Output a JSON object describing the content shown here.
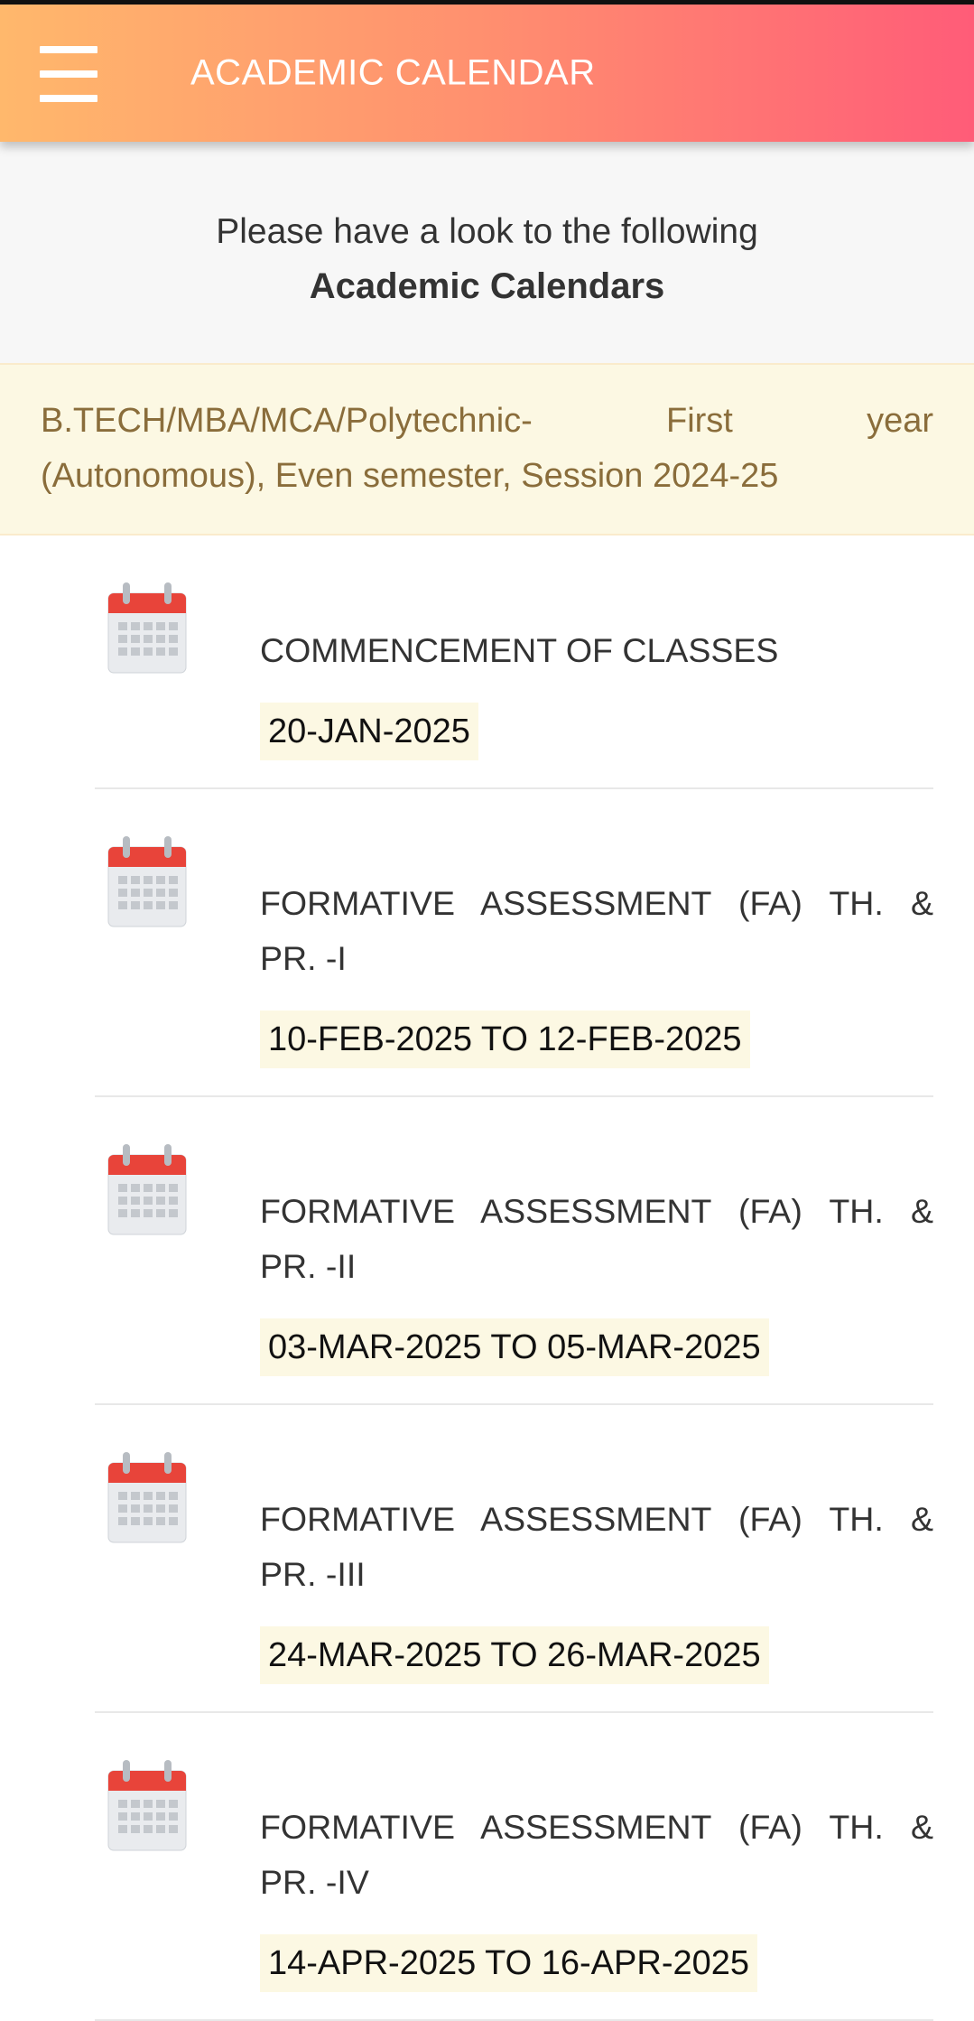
{
  "header": {
    "title": "ACADEMIC CALENDAR",
    "menu_icon": "hamburger-menu-icon"
  },
  "intro": {
    "line": "Please have a look to the following",
    "strong": "Academic Calendars"
  },
  "notice": {
    "line1": "B.TECH/MBA/MCA/Polytechnic- First year",
    "line2": "(Autonomous), Even semester, Session 2024-25"
  },
  "colors": {
    "header_start": "#ffb86c",
    "header_end": "#ff5c78",
    "highlight_bg": "#fcf8e3",
    "notice_text": "#8a6d3b"
  },
  "events": [
    {
      "icon": "calendar-icon",
      "title_line1": "COMMENCEMENT OF CLASSES",
      "title_line2": "",
      "date": "20-JAN-2025"
    },
    {
      "icon": "calendar-icon",
      "title_line1": "FORMATIVE ASSESSMENT (FA) TH. &",
      "title_line2": "PR. -I",
      "date": "10-FEB-2025 TO 12-FEB-2025"
    },
    {
      "icon": "calendar-icon",
      "title_line1": "FORMATIVE ASSESSMENT (FA) TH. &",
      "title_line2": "PR. -II",
      "date": "03-MAR-2025 TO 05-MAR-2025"
    },
    {
      "icon": "calendar-icon",
      "title_line1": "FORMATIVE ASSESSMENT (FA) TH. &",
      "title_line2": "PR. -III",
      "date": "24-MAR-2025 TO 26-MAR-2025"
    },
    {
      "icon": "calendar-icon",
      "title_line1": "FORMATIVE ASSESSMENT (FA) TH. &",
      "title_line2": "PR. -IV",
      "date": "14-APR-2025 TO 16-APR-2025"
    }
  ]
}
